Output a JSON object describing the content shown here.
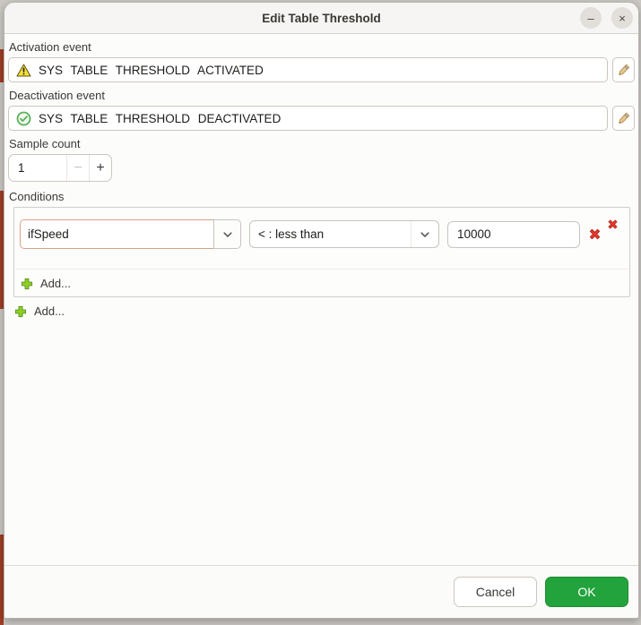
{
  "window": {
    "title": "Edit Table Threshold",
    "minimize_glyph": "–",
    "close_glyph": "×"
  },
  "activation": {
    "label": "Activation event",
    "value": "SYS TABLE THRESHOLD ACTIVATED"
  },
  "deactivation": {
    "label": "Deactivation event",
    "value": "SYS TABLE THRESHOLD DEACTIVATED"
  },
  "sample_count": {
    "label": "Sample count",
    "value": "1",
    "decrement_glyph": "−",
    "increment_glyph": "+"
  },
  "conditions": {
    "label": "Conditions",
    "rows": [
      {
        "variable": "ifSpeed",
        "operator": "< : less than",
        "value": "10000"
      }
    ],
    "add_condition_label": "Add...",
    "add_group_label": "Add..."
  },
  "footer": {
    "cancel_label": "Cancel",
    "ok_label": "OK"
  },
  "colors": {
    "ok_green": "#23a33c",
    "delete_red": "#e2372b",
    "add_green": "#8ed01f",
    "warning_yellow": "#f5e03a",
    "check_green": "#58b158",
    "entry_focus_border": "#d8a287"
  }
}
